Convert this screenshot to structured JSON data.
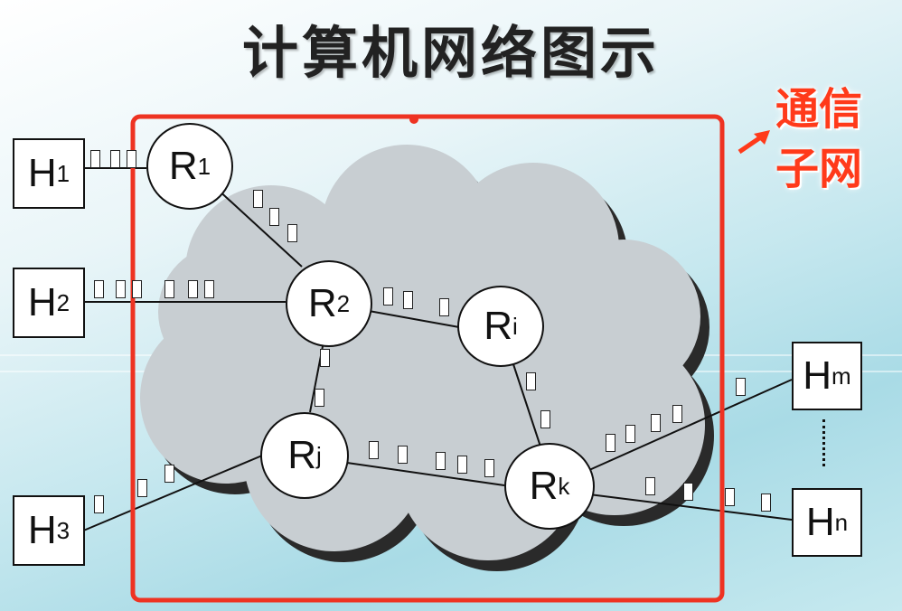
{
  "title": "计算机网络图示",
  "subnet_label": [
    "通信",
    "子网"
  ],
  "colors": {
    "frame": "#ee3322",
    "label": "#ff3a1a",
    "cloud": "#c8ced2",
    "cloud_shadow": "#2a2a2a"
  },
  "hosts": [
    {
      "id": "H1",
      "base": "H",
      "sub": "1"
    },
    {
      "id": "H2",
      "base": "H",
      "sub": "2"
    },
    {
      "id": "H3",
      "base": "H",
      "sub": "3"
    },
    {
      "id": "Hm",
      "base": "H",
      "sub": "m"
    },
    {
      "id": "Hn",
      "base": "H",
      "sub": "n"
    }
  ],
  "routers": [
    {
      "id": "R1",
      "base": "R",
      "sub": "1"
    },
    {
      "id": "R2",
      "base": "R",
      "sub": "2"
    },
    {
      "id": "Ri",
      "base": "R",
      "sub": "i"
    },
    {
      "id": "Rj",
      "base": "R",
      "sub": "j"
    },
    {
      "id": "Rk",
      "base": "R",
      "sub": "k"
    }
  ],
  "links": [
    [
      "H1",
      "R1"
    ],
    [
      "H2",
      "R2"
    ],
    [
      "H3",
      "Rj"
    ],
    [
      "R1",
      "R2"
    ],
    [
      "R2",
      "Ri"
    ],
    [
      "R2",
      "Rj"
    ],
    [
      "Ri",
      "Rk"
    ],
    [
      "Rj",
      "Rk"
    ],
    [
      "Rk",
      "Hm"
    ],
    [
      "Rk",
      "Hn"
    ]
  ]
}
